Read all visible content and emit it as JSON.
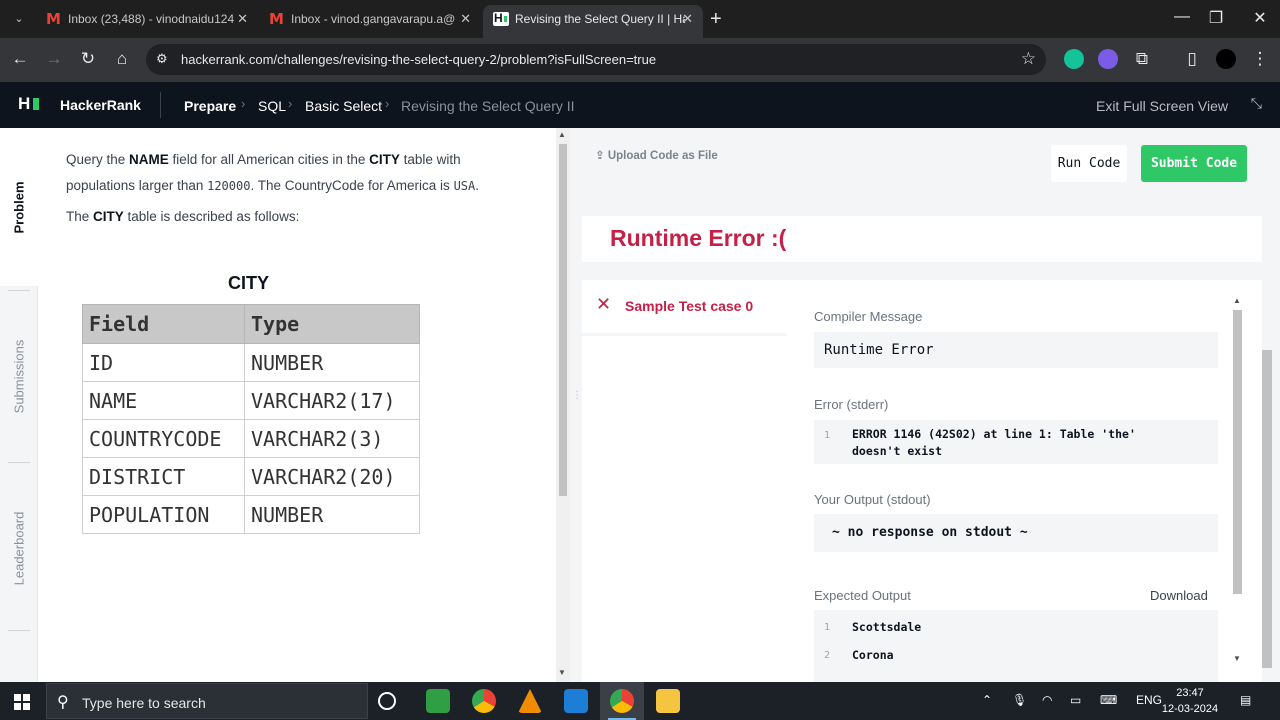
{
  "browser": {
    "tabs": [
      {
        "title": "Inbox (23,488) - vinodnaidu124",
        "active": false
      },
      {
        "title": "Inbox - vinod.gangavarapu.a@",
        "active": false
      },
      {
        "title": "Revising the Select Query II | Ha",
        "active": true
      }
    ],
    "url": "hackerrank.com/challenges/revising-the-select-query-2/problem?isFullScreen=true"
  },
  "header": {
    "brand": "HackerRank",
    "breadcrumbs": [
      "Prepare",
      "SQL",
      "Basic Select",
      "Revising the Select Query II"
    ],
    "exit_fullscreen": "Exit Full Screen View"
  },
  "rail": {
    "items": [
      "Problem",
      "Submissions",
      "Leaderboard"
    ]
  },
  "problem": {
    "p1": {
      "a": "Query the ",
      "b": "NAME",
      "c": " field for all American cities in the ",
      "d": "CITY",
      "e": " table with"
    },
    "p2": {
      "a": "populations larger than ",
      "b": "120000",
      "c": ". The CountryCode for America is ",
      "d": "USA",
      "e": "."
    },
    "p3": {
      "a": "The ",
      "b": "CITY",
      "c": " table is described as follows:"
    },
    "table_title": "CITY",
    "columns": [
      "Field",
      "Type"
    ],
    "rows": [
      [
        "ID",
        "NUMBER"
      ],
      [
        "NAME",
        "VARCHAR2(17)"
      ],
      [
        "COUNTRYCODE",
        "VARCHAR2(3)"
      ],
      [
        "DISTRICT",
        "VARCHAR2(20)"
      ],
      [
        "POPULATION",
        "NUMBER"
      ]
    ]
  },
  "editor": {
    "upload": "Upload Code as File",
    "run": "Run Code",
    "submit": "Submit Code",
    "status": "Runtime Error :(",
    "testcase": "Sample Test case 0",
    "compiler_label": "Compiler Message",
    "compiler_msg": "Runtime Error",
    "stderr_label": "Error (stderr)",
    "stderr_line_no": "1",
    "stderr_msg": "ERROR 1146 (42S02) at line 1: Table 'the' doesn't exist",
    "stdout_label": "Your Output (stdout)",
    "stdout_msg": "~ no response on stdout ~",
    "expected_label": "Expected Output",
    "download": "Download",
    "expected_lines": [
      {
        "no": "1",
        "text": "Scottsdale"
      },
      {
        "no": "2",
        "text": "Corona"
      }
    ]
  },
  "taskbar": {
    "search_placeholder": "Type here to search",
    "lang": "ENG",
    "time": "23:47",
    "date": "12-03-2024"
  },
  "colors": {
    "hr_dark": "#0e141e",
    "hr_green": "#2ec866",
    "error_red": "#c52047"
  }
}
